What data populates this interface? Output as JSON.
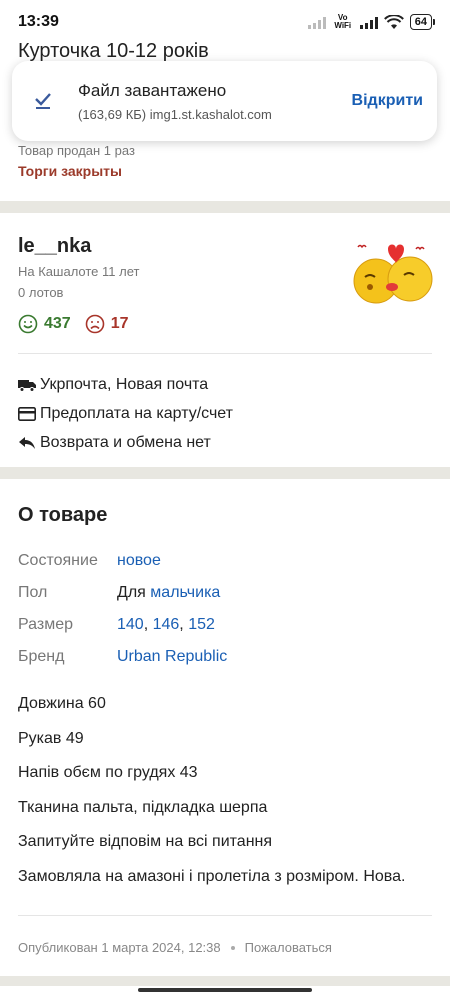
{
  "status": {
    "time": "13:39",
    "network": "Vo WiFi",
    "battery": "64"
  },
  "item": {
    "title_partial": "Курточка 10-12 років"
  },
  "toast": {
    "title": "Файл завантажено",
    "subtitle": "(163,69 КБ) img1.st.kashalot.com",
    "action": "Відкрити"
  },
  "sale": {
    "sold": "Товар продан 1 раз",
    "closed": "Торги закрыты"
  },
  "seller": {
    "name": "le__nka",
    "member_since": "На Кашалоте 11 лет",
    "lots": "0 лотов",
    "positive": "437",
    "negative": "17"
  },
  "delivery": {
    "shipping": "Укрпочта, Новая почта",
    "payment": "Предоплата на карту/счет",
    "returns": "Возврата и обмена нет"
  },
  "about": {
    "heading": "О товаре",
    "condition_label": "Состояние",
    "condition_value": "новое",
    "gender_label": "Пол",
    "gender_prefix": "Для",
    "gender_value": "мальчика",
    "size_label": "Размер",
    "sizes": [
      "140",
      "146",
      "152"
    ],
    "size_separator": ", ",
    "brand_label": "Бренд",
    "brand_value": "Urban Republic",
    "description": [
      "Довжина 60",
      "Рукав 49",
      "Напів обєм по грудях 43",
      "Тканина пальта, підкладка шерпа",
      "Запитуйте відповім на всі питання",
      "Замовляла на амазоні і пролетіла з розміром. Нова."
    ]
  },
  "footer": {
    "published": "Опубликован 1 марта 2024, 12:38",
    "report": "Пожаловаться"
  },
  "colors": {
    "link": "#1a5fb4",
    "positive": "#3a7a30",
    "negative": "#a8352a",
    "closed": "#9b3a2a",
    "band": "#e8e7e1"
  }
}
